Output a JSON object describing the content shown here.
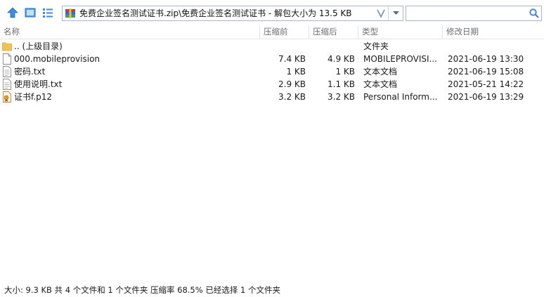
{
  "toolbar": {
    "address": "免费企业签名测试证书.zip\\免费企业签名测试证书 - 解包大小为 13.5 KB",
    "search_value": "",
    "address_dropdown_glyph": "V"
  },
  "columns": {
    "name": "名称",
    "packed": "压缩前",
    "compressed": "压缩后",
    "type": "类型",
    "modified": "修改日期"
  },
  "files": [
    {
      "icon": "folder-icon",
      "name": ".. (上级目录)",
      "packed": "",
      "compressed": "",
      "type": "文件夹",
      "modified": ""
    },
    {
      "icon": "file-icon",
      "name": "000.mobileprovision",
      "packed": "7.4 KB",
      "compressed": "4.9 KB",
      "type": "MOBILEPROVISI...",
      "modified": "2021-06-19 13:30"
    },
    {
      "icon": "text-file-icon",
      "name": "密码.txt",
      "packed": "1 KB",
      "compressed": "1 KB",
      "type": "文本文档",
      "modified": "2021-06-19 15:08"
    },
    {
      "icon": "text-file-icon",
      "name": "使用说明.txt",
      "packed": "2.9 KB",
      "compressed": "1.1 KB",
      "type": "文本文档",
      "modified": "2021-05-21 14:22"
    },
    {
      "icon": "certificate-icon",
      "name": "证书f.p12",
      "packed": "3.2 KB",
      "compressed": "3.2 KB",
      "type": "Personal Inform...",
      "modified": "2021-06-19 13:29"
    }
  ],
  "status": {
    "text": "大小: 9.3 KB 共 4 个文件和 1 个文件夹 压缩率 68.5% 已经选择 1 个文件夹"
  },
  "colors": {
    "accent": "#2f7fd6",
    "folder": "#f2c24f",
    "archive_red": "#c83a3a",
    "archive_blue": "#3a6fc8"
  }
}
